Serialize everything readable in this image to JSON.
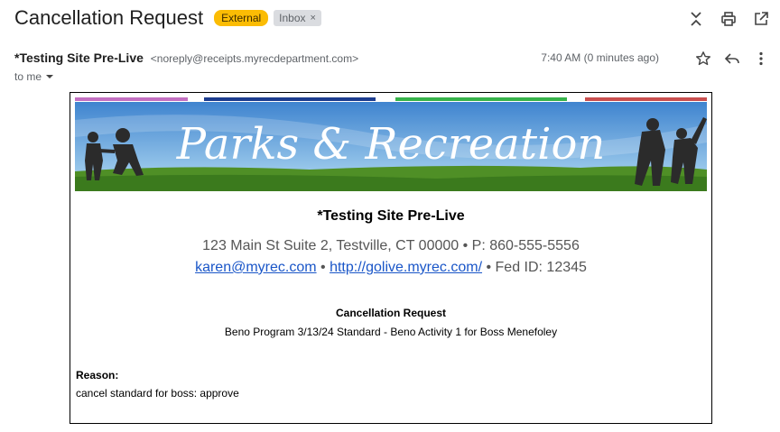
{
  "subject": {
    "title": "Cancellation Request",
    "label_external": "External",
    "label_inbox": "Inbox",
    "label_close_glyph": "×"
  },
  "toolbar_icons": [
    "collapse-icon",
    "print-icon",
    "open-in-new-window-icon"
  ],
  "message": {
    "sender_name": "*Testing Site Pre-Live",
    "sender_email": "<noreply@receipts.myrecdepartment.com>",
    "recipient": "to me",
    "timestamp": "7:40 AM (0 minutes ago)",
    "action_icons": [
      "star-icon",
      "reply-icon",
      "more-options-icon"
    ]
  },
  "email_body": {
    "banner_text": "Parks & Recreation",
    "banner_stripe_colors": [
      "#c36fc1",
      "#1d3d8f",
      "#37b34a",
      "#c94f4f"
    ],
    "org_name": "*Testing Site Pre-Live",
    "address": "123 Main St Suite 2, Testville, CT 00000 • P: 860-555-5556",
    "email_link": "karen@myrec.com",
    "separator": " • ",
    "website_link": "http://golive.myrec.com/",
    "fed_id": " • Fed ID: 12345",
    "request_title": "Cancellation Request",
    "request_detail": "Beno Program 3/13/24 Standard - Beno Activity 1 for Boss Menefoley",
    "reason_label": "Reason:",
    "reason_text": "cancel standard for boss: approve"
  },
  "colors": {
    "external_chip": "#fbbc04",
    "inbox_chip": "#dadce0",
    "link": "#1a56c8"
  }
}
